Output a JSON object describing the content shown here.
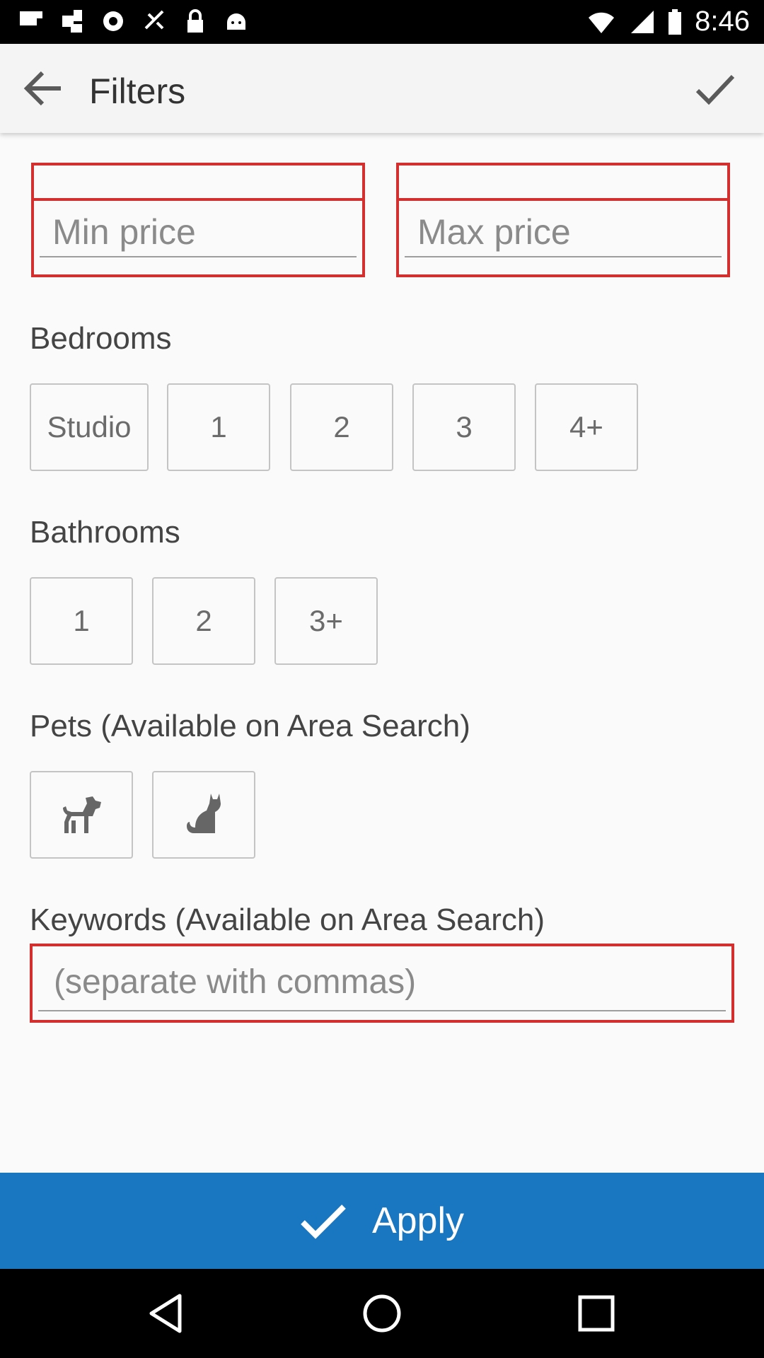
{
  "status_bar": {
    "time": "8:46",
    "icons": [
      "flipboard-icon",
      "photos-icon",
      "sync-icon",
      "fake-gps-icon",
      "lock-icon",
      "android-icon",
      "wifi-icon",
      "signal-icon",
      "battery-icon"
    ]
  },
  "toolbar": {
    "title": "Filters",
    "back_icon": "arrow-back-icon",
    "done_icon": "check-icon"
  },
  "price": {
    "min_placeholder": "Min price",
    "max_placeholder": "Max price",
    "min_value": "",
    "max_value": ""
  },
  "bedrooms": {
    "label": "Bedrooms",
    "options": [
      "Studio",
      "1",
      "2",
      "3",
      "4+"
    ]
  },
  "bathrooms": {
    "label": "Bathrooms",
    "options": [
      "1",
      "2",
      "3+"
    ]
  },
  "pets": {
    "label": "Pets (Available on Area Search)",
    "options": [
      "dog-icon",
      "cat-icon"
    ]
  },
  "keywords": {
    "label": "Keywords (Available on Area Search)",
    "placeholder": "(separate with commas)",
    "value": ""
  },
  "apply": {
    "label": "Apply",
    "color": "#1976c0"
  },
  "highlight_color": "#d32f2f"
}
